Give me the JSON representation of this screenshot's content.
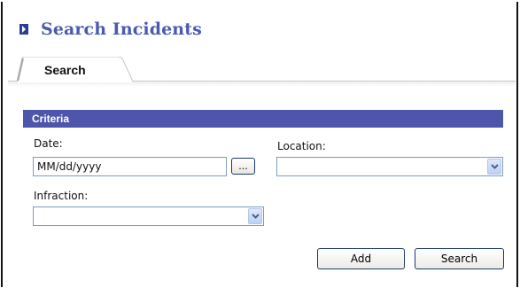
{
  "page": {
    "title": "Search Incidents"
  },
  "tabs": [
    {
      "label": "Search",
      "active": true
    }
  ],
  "criteria": {
    "header": "Criteria",
    "date": {
      "label": "Date:",
      "value": "MM/dd/yyyy",
      "picker_label": "..."
    },
    "location": {
      "label": "Location:",
      "value": ""
    },
    "infraction": {
      "label": "Infraction:",
      "value": ""
    }
  },
  "actions": {
    "add_label": "Add",
    "search_label": "Search"
  },
  "colors": {
    "title": "#4a5ab0",
    "criteria_header_bg": "#4d56aa",
    "button_border": "#1c3a70",
    "input_border": "#7f9db9"
  }
}
